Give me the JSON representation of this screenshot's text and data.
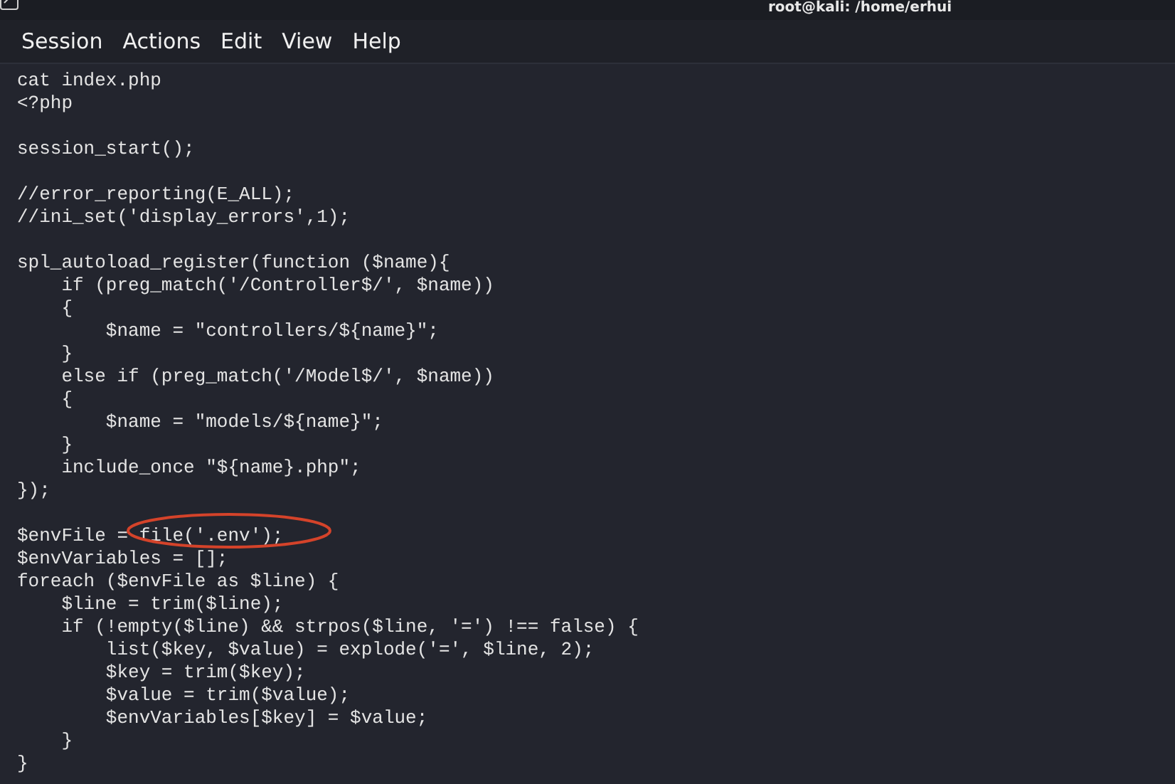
{
  "window": {
    "title": "root@kali: /home/erhui"
  },
  "menu": [
    "Session",
    "Actions",
    "Edit",
    "View",
    "Help"
  ],
  "terminal_output": "cat index.php\n<?php\n\nsession_start();\n\n//error_reporting(E_ALL);\n//ini_set('display_errors',1);\n\nspl_autoload_register(function ($name){\n    if (preg_match('/Controller$/', $name))\n    {\n        $name = \"controllers/${name}\";\n    }\n    else if (preg_match('/Model$/', $name))\n    {\n        $name = \"models/${name}\";\n    }\n    include_once \"${name}.php\";\n});\n\n$envFile = file('.env');\n$envVariables = [];\nforeach ($envFile as $line) {\n    $line = trim($line);\n    if (!empty($line) && strpos($line, '=') !== false) {\n        list($key, $value) = explode('=', $line, 2);\n        $key = trim($key);\n        $value = trim($value);\n        $envVariables[$key] = $value;\n    }\n}"
}
